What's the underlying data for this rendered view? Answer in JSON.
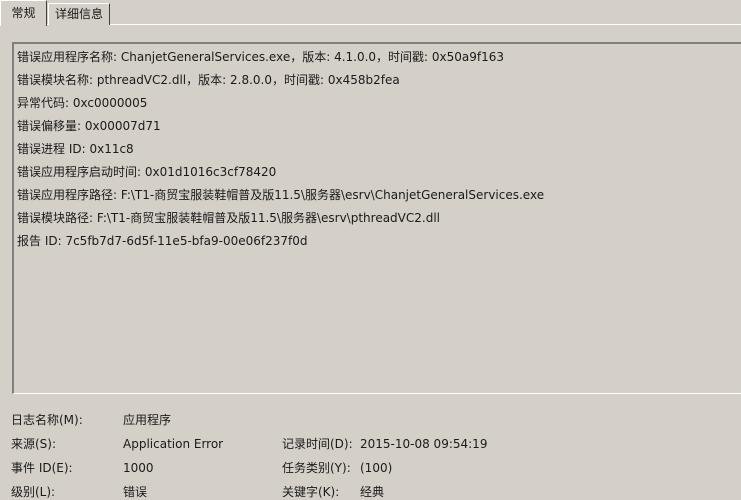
{
  "tabs": [
    {
      "label": "常规"
    },
    {
      "label": "详细信息"
    }
  ],
  "description_lines": [
    "错误应用程序名称: ChanjetGeneralServices.exe，版本: 4.1.0.0，时间戳: 0x50a9f163",
    "错误模块名称: pthreadVC2.dll，版本: 2.8.0.0，时间戳: 0x458b2fea",
    "异常代码: 0xc0000005",
    "错误偏移量: 0x00007d71",
    "错误进程 ID: 0x11c8",
    "错误应用程序启动时间: 0x01d1016c3cf78420",
    "错误应用程序路径: F:\\T1-商贸宝服装鞋帽普及版11.5\\服务器\\esrv\\ChanjetGeneralServices.exe",
    "错误模块路径: F:\\T1-商贸宝服装鞋帽普及版11.5\\服务器\\esrv\\pthreadVC2.dll",
    "报告 ID: 7c5fb7d7-6d5f-11e5-bfa9-00e06f237f0d"
  ],
  "details": {
    "log_name_label": "日志名称(M):",
    "log_name_value": "应用程序",
    "source_label": "来源(S):",
    "source_value": "Application Error",
    "logged_label": "记录时间(D):",
    "logged_value": "2015-10-08 09:54:19",
    "event_id_label": "事件 ID(E):",
    "event_id_value": "1000",
    "task_category_label": "任务类别(Y):",
    "task_category_value": "(100)",
    "level_label": "级别(L):",
    "level_value": "错误",
    "keywords_label": "关键字(K):",
    "keywords_value": "经典"
  }
}
